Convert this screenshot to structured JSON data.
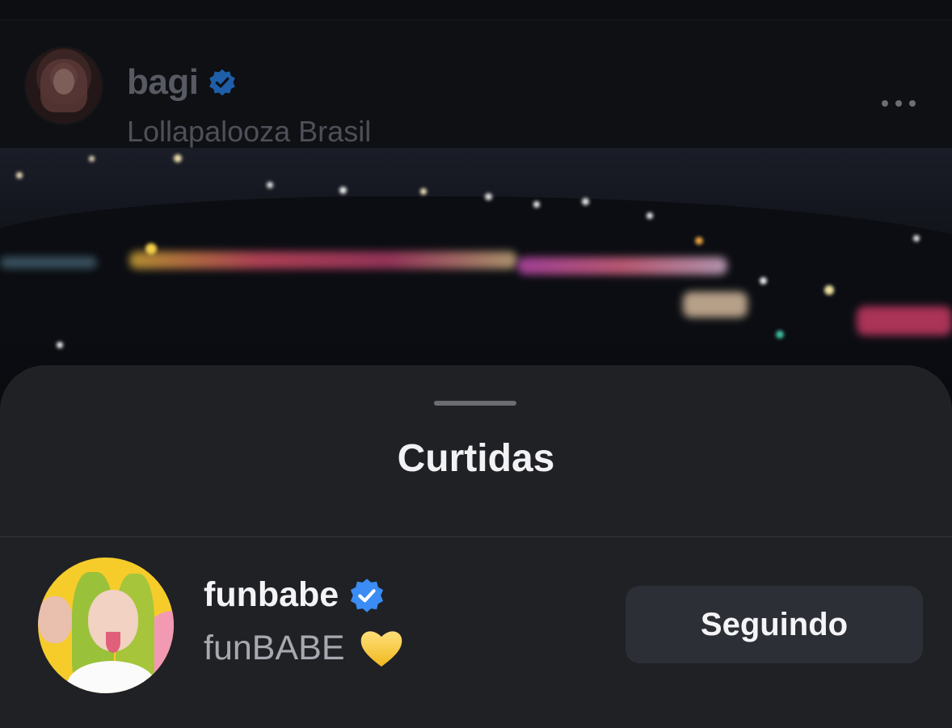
{
  "post": {
    "username": "bagi",
    "location": "Lollapalooza Brasil",
    "verified_color": "#1f5ea8"
  },
  "likes_sheet": {
    "title": "Curtidas",
    "users": [
      {
        "username": "funbabe",
        "full_name": "funBABE",
        "emoji": "yellow-heart",
        "verified_color": "#3b8cf5",
        "follow_button_label": "Seguindo"
      }
    ]
  },
  "colors": {
    "sheet_background": "#202125",
    "button_background": "#2c2f35"
  }
}
